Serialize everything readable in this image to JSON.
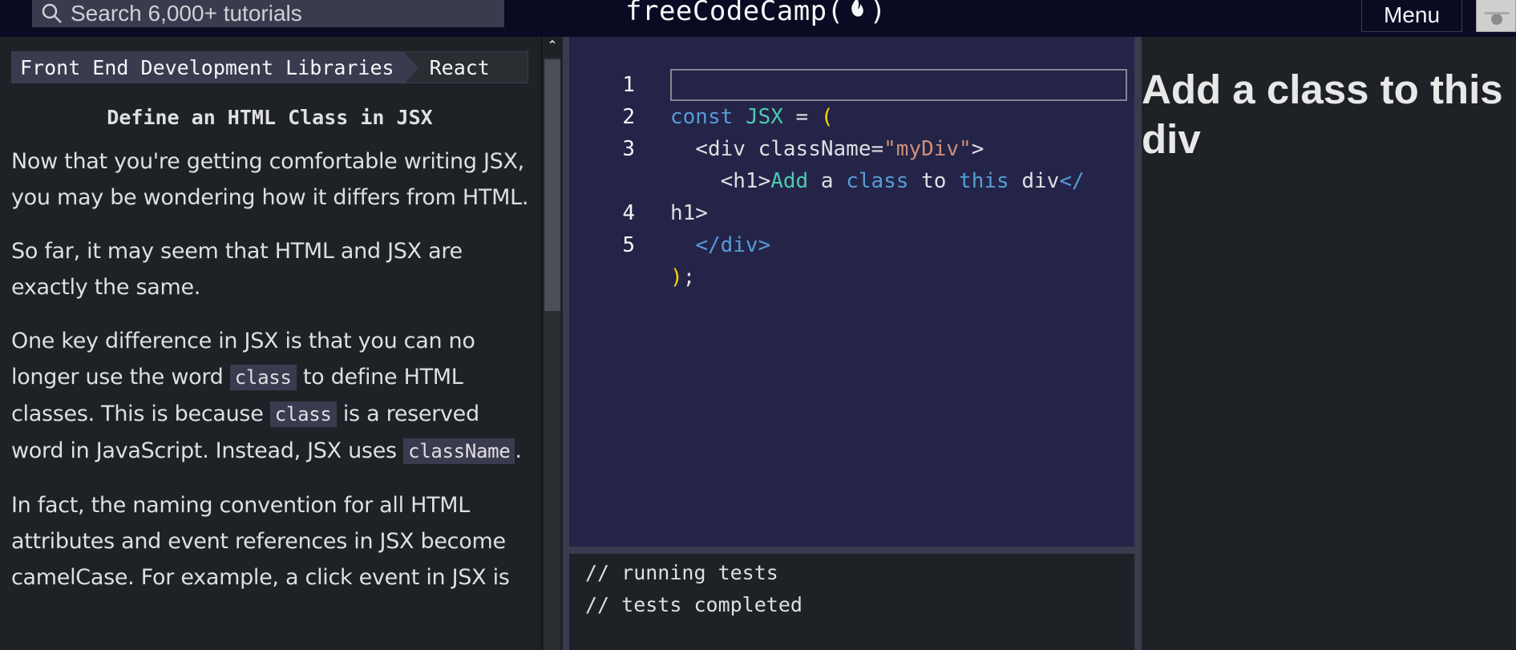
{
  "topnav": {
    "search_placeholder": "Search 6,000+ tutorials",
    "logo_left": "freeCodeCamp(",
    "logo_right": ")",
    "menu_label": "Menu"
  },
  "breadcrumb": {
    "first": "Front End Development Libraries",
    "second": "React"
  },
  "challenge": {
    "title": "Define an HTML Class in JSX",
    "p1": "Now that you're getting comfortable writing JSX, you may be wondering how it differs from HTML.",
    "p2": "So far, it may seem that HTML and JSX are exactly the same.",
    "p3_a": "One key difference in JSX is that you can no longer use the word ",
    "p3_code1": "class",
    "p3_b": " to define HTML classes. This is because ",
    "p3_code2": "class",
    "p3_c": " is a reserved word in JavaScript. Instead, JSX uses ",
    "p3_code3": "className",
    "p3_d": ".",
    "p4": "In fact, the naming convention for all HTML attributes and event references in JSX become camelCase. For example, a click event in JSX is"
  },
  "scrollbar": {
    "up_arrow": "⌃"
  },
  "editor": {
    "line_numbers": [
      "1",
      "2",
      "3",
      "",
      "4",
      "5"
    ],
    "l1": {
      "kw": "const",
      "id": "JSX",
      "eq": " = ",
      "paren": "("
    },
    "l2": {
      "indent": "  ",
      "open": "<div ",
      "attr": "className=",
      "str": "\"myDiv\"",
      "close": ">"
    },
    "l3": {
      "indent": "    ",
      "open": "<h1>",
      "w1": "Add",
      "w2": " a ",
      "w3": "class",
      "w4": " to ",
      "w5": "this",
      "w6": " div",
      "close": "</"
    },
    "l3b": {
      "text": "h1>"
    },
    "l4": {
      "indent": "  ",
      "close": "</div>"
    },
    "l5": {
      "paren": ")",
      "semi": ";"
    }
  },
  "console": {
    "lines": [
      "// running tests",
      "// tests completed"
    ]
  },
  "preview": {
    "h1": "Add a class to this div"
  }
}
